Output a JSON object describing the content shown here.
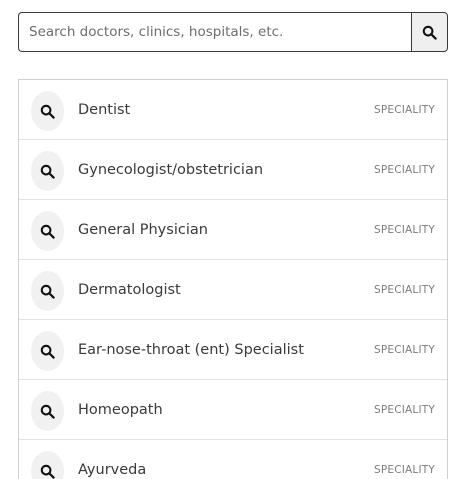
{
  "search": {
    "placeholder": "Search doctors, clinics, hospitals, etc.",
    "value": "",
    "button_icon": "search-icon"
  },
  "results": [
    {
      "label": "Dentist",
      "type": "SPECIALITY",
      "icon": "search-icon"
    },
    {
      "label": "Gynecologist/obstetrician",
      "type": "SPECIALITY",
      "icon": "search-icon"
    },
    {
      "label": "General Physician",
      "type": "SPECIALITY",
      "icon": "search-icon"
    },
    {
      "label": "Dermatologist",
      "type": "SPECIALITY",
      "icon": "search-icon"
    },
    {
      "label": "Ear-nose-throat (ent) Specialist",
      "type": "SPECIALITY",
      "icon": "search-icon"
    },
    {
      "label": "Homeopath",
      "type": "SPECIALITY",
      "icon": "search-icon"
    },
    {
      "label": "Ayurveda",
      "type": "SPECIALITY",
      "icon": "search-icon"
    }
  ],
  "colors": {
    "border": "#3a3a3a",
    "icon_bg": "#f1f1f1",
    "text": "#3a3a3a",
    "muted": "#7d7d7d"
  }
}
